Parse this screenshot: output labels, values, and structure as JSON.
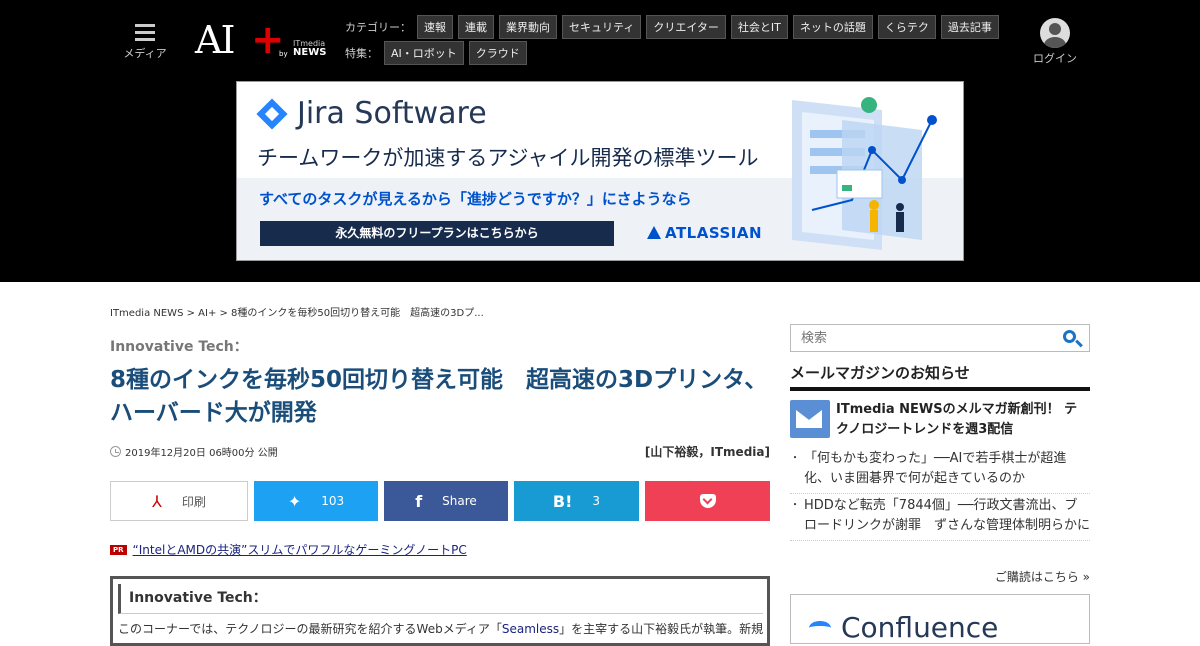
{
  "header": {
    "menu_label": "メディア",
    "logo": {
      "ai": "AI",
      "plus": "+",
      "by": "by",
      "itmedia": "ITmedia",
      "news": "NEWS"
    },
    "category_label": "カテゴリー：",
    "categories": [
      "速報",
      "連載",
      "業界動向",
      "セキュリティ",
      "クリエイター",
      "社会とIT",
      "ネットの話題",
      "くらテク",
      "過去記事"
    ],
    "feature_label": "特集：",
    "features": [
      "AI・ロボット",
      "クラウド"
    ],
    "login_label": "ログイン"
  },
  "ad": {
    "brand": "Jira Software",
    "tagline": "チームワークが加速するアジャイル開発の標準ツール",
    "sub": "すべてのタスクが見えるから「進捗どうですか？」にさようなら",
    "cta": "永久無料のフリープランはこちらから",
    "company": "ATLASSIAN"
  },
  "article": {
    "breadcrumb": "ITmedia NEWS > AI+ > 8種のインクを毎秒50回切り替え可能　超高速の3Dプ...",
    "series": "Innovative Tech：",
    "title": "8種のインクを毎秒50回切り替え可能　超高速の3Dプリンタ、ハーバード大が開発",
    "date": "2019年12月20日 06時00分 公開",
    "author": "[山下裕毅，ITmedia]"
  },
  "share": {
    "print": "印刷",
    "twitter_count": "103",
    "facebook": "Share",
    "hatena_icon": "B!",
    "hatena_count": "3"
  },
  "pr": {
    "badge": "PR",
    "text": "“IntelとAMDの共演”スリムでパワフルなゲーミングノートPC"
  },
  "notebox": {
    "head": "Innovative Tech：",
    "body_prefix": "このコーナーでは、テクノロジーの最新研究を紹介するWebメディア「",
    "body_link": "Seamless",
    "body_suffix": "」を主宰する山下裕毅氏が執筆。新規"
  },
  "sidebar": {
    "search_placeholder": "検索",
    "mm_head": "メールマガジンのお知らせ",
    "mm_feature": "ITmedia NEWSのメルマガ新創刊！ テクノロジートレンドを週3配信",
    "mm_items": [
      "「何もかも変わった」──AIで若手棋士が超進化、いま囲碁界で何が起きているのか",
      "HDDなど転売「7844個」──行政文書流出、ブロードリンクが謝罪　ずさんな管理体制明らかに"
    ],
    "mm_more": "ご購読はこちら »",
    "side_ad_brand": "Confluence"
  },
  "colors": {
    "title_blue": "#1a4d7a",
    "twitter": "#1da1f2",
    "facebook": "#3b5998",
    "hatena": "#189ad3",
    "pocket": "#ef4056"
  }
}
